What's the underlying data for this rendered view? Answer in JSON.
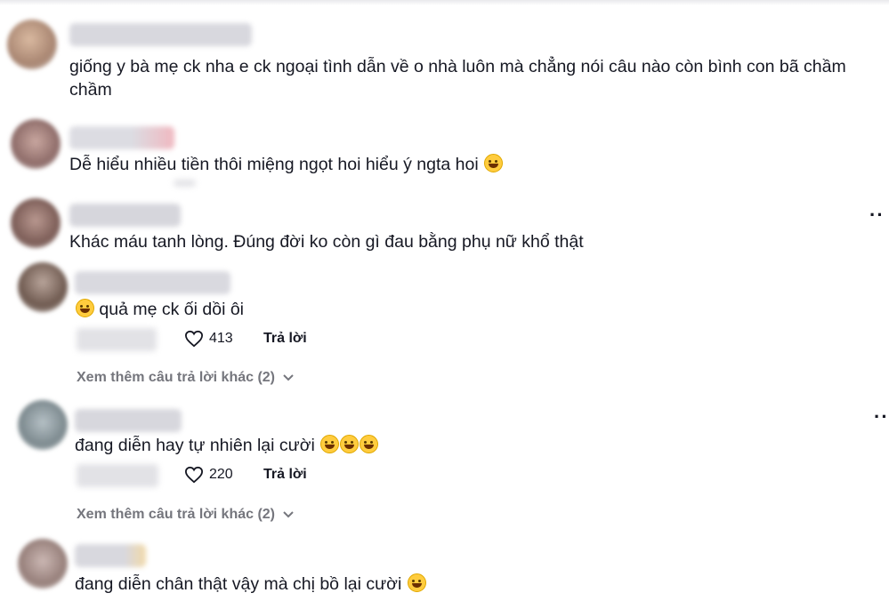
{
  "comments": [
    {
      "text": "giống y bà mẹ ck nha e ck ngoại tình dẫn về o nhà luôn mà chẳng nói câu nào còn bình con bã chầm",
      "text2": "chầm"
    },
    {
      "text": "Dễ hiểu nhiều tiền thôi miệng ngọt hoi hiểu ý ngta hoi"
    },
    {
      "text": "Khác máu tanh lòng. Đúng đời ko còn gì đau bằng phụ nữ khổ thật"
    },
    {
      "text": "quả mẹ ck ối dồi ôi",
      "likes": "413",
      "reply": "Trả lời",
      "more": "Xem thêm câu trả lời khác (2)"
    },
    {
      "text": "đang diễn hay tự nhiên lại cười",
      "likes": "220",
      "reply": "Trả lời",
      "more": "Xem thêm câu trả lời khác (2)"
    },
    {
      "text": "đang diễn chân thật vậy mà chị bồ lại cười"
    }
  ],
  "icons": {
    "like": "heart-outline-icon",
    "more": "chevron-down-icon",
    "options": "more-dots-icon",
    "emoji_smile": "grinning-emoji",
    "emoji_laugh": "laughing-tears-emoji",
    "emoji_sweat": "sweat-smile-emoji"
  },
  "colors": {
    "text": "#161823",
    "muted": "#75767d"
  }
}
